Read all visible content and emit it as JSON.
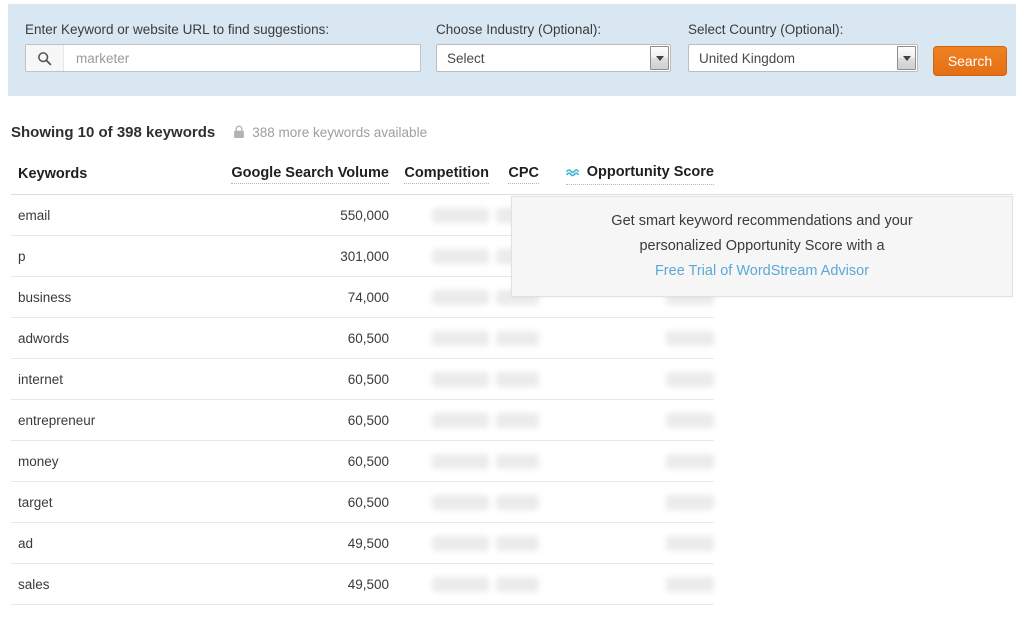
{
  "search_bar": {
    "keyword": {
      "label": "Enter Keyword or website URL to find suggestions:",
      "value": "marketer",
      "placeholder": "marketer",
      "icon": "search-icon"
    },
    "industry": {
      "label": "Choose Industry (Optional):",
      "value": "Select"
    },
    "country": {
      "label": "Select Country (Optional):",
      "value": "United Kingdom"
    },
    "search_button": {
      "label": "Search",
      "color": "#e87322"
    },
    "background_color": "#d8e7f2"
  },
  "results": {
    "showing_text": "Showing 10 of 398 keywords",
    "lock_icon": "lock-icon",
    "more_available_text": "388 more keywords available",
    "shown_count": 10,
    "total_count": 398,
    "locked_count": 388
  },
  "table": {
    "headers": {
      "keywords": "Keywords",
      "volume": "Google Search Volume",
      "competition": "Competition",
      "cpc": "CPC",
      "opportunity": "Opportunity Score",
      "opportunity_icon": "wave-icon"
    },
    "rows": [
      {
        "keyword": "email",
        "volume": "550,000",
        "competition": "",
        "cpc": "",
        "opportunity": ""
      },
      {
        "keyword": "p",
        "volume": "301,000",
        "competition": "",
        "cpc": "",
        "opportunity": ""
      },
      {
        "keyword": "business",
        "volume": "74,000",
        "competition": "",
        "cpc": "",
        "opportunity": ""
      },
      {
        "keyword": "adwords",
        "volume": "60,500",
        "competition": "",
        "cpc": "",
        "opportunity": ""
      },
      {
        "keyword": "internet",
        "volume": "60,500",
        "competition": "",
        "cpc": "",
        "opportunity": ""
      },
      {
        "keyword": "entrepreneur",
        "volume": "60,500",
        "competition": "",
        "cpc": "",
        "opportunity": ""
      },
      {
        "keyword": "money",
        "volume": "60,500",
        "competition": "",
        "cpc": "",
        "opportunity": ""
      },
      {
        "keyword": "target",
        "volume": "60,500",
        "competition": "",
        "cpc": "",
        "opportunity": ""
      },
      {
        "keyword": "ad",
        "volume": "49,500",
        "competition": "",
        "cpc": "",
        "opportunity": ""
      },
      {
        "keyword": "sales",
        "volume": "49,500",
        "competition": "",
        "cpc": "",
        "opportunity": ""
      }
    ]
  },
  "promo_tooltip": {
    "line1": "Get smart keyword recommendations and your",
    "line2": "personalized Opportunity Score with a",
    "link": "Free Trial of WordStream Advisor",
    "link_color": "#5aa9d6"
  }
}
